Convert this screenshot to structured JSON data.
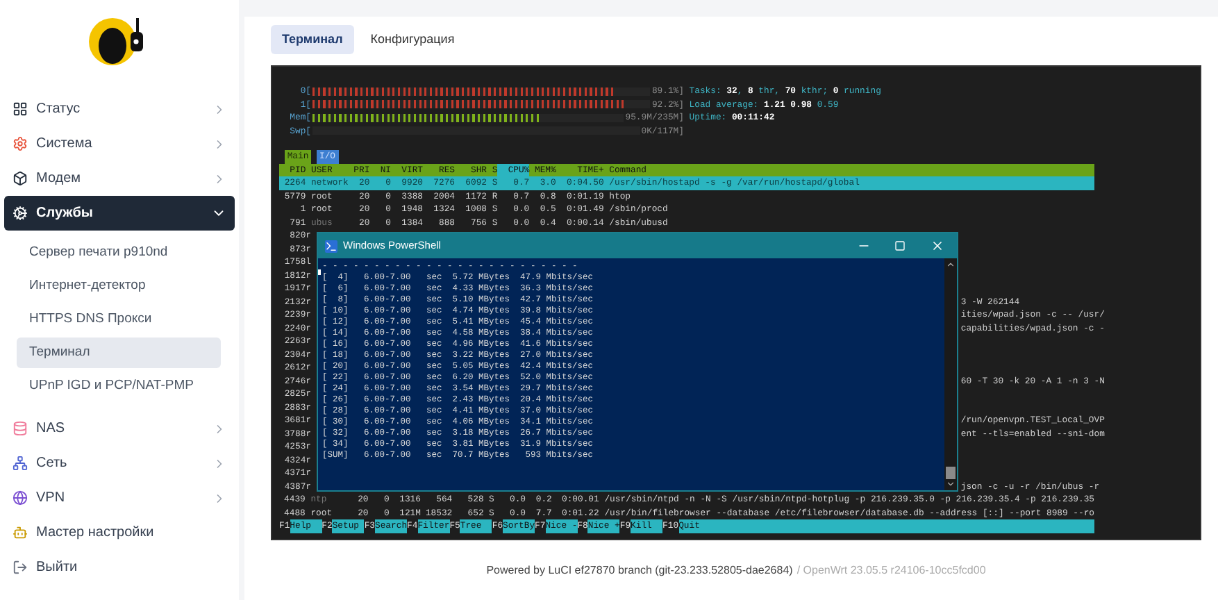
{
  "sidebar": {
    "items": [
      {
        "label": "Статус",
        "expanded": false,
        "selected": false
      },
      {
        "label": "Система",
        "expanded": false,
        "selected": false
      },
      {
        "label": "Модем",
        "expanded": false,
        "selected": false
      },
      {
        "label": "Службы",
        "expanded": true,
        "selected": true,
        "children": [
          {
            "label": "Сервер печати p910nd",
            "selected": false
          },
          {
            "label": "Интернет-детектор",
            "selected": false
          },
          {
            "label": "HTTPS DNS Прокси",
            "selected": false
          },
          {
            "label": "Терминал",
            "selected": true
          },
          {
            "label": "UPnP IGD и PCP/NAT-PMP",
            "selected": false
          }
        ]
      },
      {
        "label": "NAS",
        "expanded": false,
        "selected": false
      },
      {
        "label": "Сеть",
        "expanded": false,
        "selected": false
      },
      {
        "label": "VPN",
        "expanded": false,
        "selected": false
      },
      {
        "label": "Мастер настройки",
        "selected": false
      },
      {
        "label": "Выйти",
        "selected": false
      }
    ]
  },
  "tabs": [
    {
      "label": "Терминал",
      "selected": true
    },
    {
      "label": "Конфигурация",
      "selected": false
    }
  ],
  "htop": {
    "meters": [
      {
        "label": "0[",
        "reading": "89.1%]",
        "level": 0.89,
        "color": "#c0392b"
      },
      {
        "label": "1[",
        "reading": "92.2%]",
        "level": 0.92,
        "color": "#c0392b"
      },
      {
        "label": "Mem[",
        "reading": "95.9M/235M]",
        "level": 0.73,
        "color": "#7fb31a"
      },
      {
        "label": "Swp[",
        "reading": "0K/117M]"
      }
    ],
    "summary": [
      "Tasks: **32**, **8** thr, **70** kthr; **0** running",
      "Load average: **1.21** **0.98** 0.59",
      "Uptime: **00:11:42**"
    ],
    "tabs": [
      {
        "label": "Main",
        "selected": true
      },
      {
        "label": "I/O",
        "selected": false
      }
    ],
    "columns": [
      {
        "label": "PID",
        "sorted": false
      },
      {
        "label": "USER",
        "sorted": false
      },
      {
        "label": "PRI",
        "sorted": false
      },
      {
        "label": "NI",
        "sorted": false
      },
      {
        "label": "VIRT",
        "sorted": false
      },
      {
        "label": "RES",
        "sorted": false
      },
      {
        "label": "SHR",
        "sorted": false
      },
      {
        "label": "S",
        "sorted": false
      },
      {
        "label": "CPU%",
        "sorted": true
      },
      {
        "label": "MEM%",
        "sorted": false
      },
      {
        "label": "TIME+",
        "sorted": false
      },
      {
        "label": "Command",
        "sorted": false
      }
    ],
    "rows": [
      {
        "kind": "full",
        "selected": true,
        "dim": false,
        "cells": [
          "2264",
          "network",
          "20",
          "0",
          "9920",
          "7276",
          "6092",
          "S",
          "0.7",
          "3.0",
          "0:04.50",
          "/usr/sbin/hostapd -s -g /var/run/hostapd/global"
        ]
      },
      {
        "kind": "full",
        "selected": false,
        "dim": false,
        "cells": [
          "5779",
          "root",
          "20",
          "0",
          "3388",
          "2004",
          "1172",
          "R",
          "0.7",
          "0.8",
          "0:01.19",
          "htop"
        ]
      },
      {
        "kind": "full",
        "selected": false,
        "dim": false,
        "cells": [
          "1",
          "root",
          "20",
          "0",
          "1948",
          "1324",
          "1008",
          "S",
          "0.0",
          "0.5",
          "0:01.49",
          "/sbin/procd"
        ]
      },
      {
        "kind": "full",
        "selected": false,
        "dim": true,
        "cells": [
          "791",
          "ubus",
          "20",
          "0",
          "1384",
          "888",
          "756",
          "S",
          "0.0",
          "0.4",
          "0:00.14",
          "/sbin/ubusd"
        ]
      },
      {
        "kind": "covered",
        "pid": "820",
        "user": "r"
      },
      {
        "kind": "covered",
        "pid": "873",
        "user": "r"
      },
      {
        "kind": "covered",
        "pid": "1758",
        "user": "l"
      },
      {
        "kind": "covered",
        "pid": "1812",
        "user": "r"
      },
      {
        "kind": "covered",
        "pid": "1917",
        "user": "r"
      },
      {
        "kind": "covered",
        "pid": "2132",
        "user": "r",
        "tail": "3 -W 262144"
      },
      {
        "kind": "covered",
        "pid": "2239",
        "user": "r",
        "tail": "ities/wpad.json -c -- /usr/"
      },
      {
        "kind": "covered",
        "pid": "2240",
        "user": "r",
        "tail": "capabilities/wpad.json -c -"
      },
      {
        "kind": "covered",
        "pid": "2263",
        "user": "r"
      },
      {
        "kind": "covered",
        "pid": "2304",
        "user": "r"
      },
      {
        "kind": "covered",
        "pid": "2612",
        "user": "r"
      },
      {
        "kind": "covered",
        "pid": "2746",
        "user": "r",
        "tail": "60 -T 30 -k 20 -A 1 -n 3 -N"
      },
      {
        "kind": "covered",
        "pid": "2825",
        "user": "r"
      },
      {
        "kind": "covered",
        "pid": "2883",
        "user": "r"
      },
      {
        "kind": "covered",
        "pid": "3681",
        "user": "r",
        "tail": "/run/openvpn.TEST_Local_OVP"
      },
      {
        "kind": "covered",
        "pid": "3788",
        "user": "r",
        "tail": "ent --tls=enabled --sni-dom"
      },
      {
        "kind": "covered",
        "pid": "4253",
        "user": "r"
      },
      {
        "kind": "covered",
        "pid": "4324",
        "user": "r"
      },
      {
        "kind": "covered",
        "pid": "4371",
        "user": "r"
      },
      {
        "kind": "covered",
        "pid": "4387",
        "user": "r",
        "tail": "json -c -u -r /bin/ubus -r"
      },
      {
        "kind": "full",
        "selected": false,
        "dim": true,
        "cells": [
          "4439",
          "ntp",
          "20",
          "0",
          "1316",
          "564",
          "528",
          "S",
          "0.0",
          "0.2",
          "0:00.01",
          "/usr/sbin/ntpd -n -N -S /usr/sbin/ntpd-hotplug -p 216.239.35.0 -p 216.239.35.4 -p 216.239.35"
        ]
      },
      {
        "kind": "full",
        "selected": false,
        "dim": false,
        "cells": [
          "4488",
          "root",
          "20",
          "0",
          "121M",
          "18532",
          "652",
          "S",
          "0.0",
          "7.7",
          "0:01.22",
          "/usr/bin/filebrowser --database /etc/filebrowser/database.db --address [::] --port 8989 --ro"
        ]
      }
    ],
    "fkeys": [
      {
        "key": "F1",
        "label": "Help"
      },
      {
        "key": "F2",
        "label": "Setup"
      },
      {
        "key": "F3",
        "label": "Search"
      },
      {
        "key": "F4",
        "label": "Filter"
      },
      {
        "key": "F5",
        "label": "Tree"
      },
      {
        "key": "F6",
        "label": "SortBy"
      },
      {
        "key": "F7",
        "label": "Nice -"
      },
      {
        "key": "F8",
        "label": "Nice +"
      },
      {
        "key": "F9",
        "label": "Kill"
      },
      {
        "key": "F10",
        "label": "Quit"
      }
    ]
  },
  "powershell": {
    "title": "Windows PowerShell",
    "lines": [
      "- - - - - - - - - - - - - - - - - - - - - - - - -",
      "[  4]   6.00-7.00   sec  5.72 MBytes  47.9 Mbits/sec",
      "[  6]   6.00-7.00   sec  4.33 MBytes  36.3 Mbits/sec",
      "[  8]   6.00-7.00   sec  5.10 MBytes  42.7 Mbits/sec",
      "[ 10]   6.00-7.00   sec  4.74 MBytes  39.8 Mbits/sec",
      "[ 12]   6.00-7.00   sec  5.41 MBytes  45.4 Mbits/sec",
      "[ 14]   6.00-7.00   sec  4.58 MBytes  38.4 Mbits/sec",
      "[ 16]   6.00-7.00   sec  4.96 MBytes  41.6 Mbits/sec",
      "[ 18]   6.00-7.00   sec  3.22 MBytes  27.0 Mbits/sec",
      "[ 20]   6.00-7.00   sec  5.05 MBytes  42.4 Mbits/sec",
      "[ 22]   6.00-7.00   sec  6.20 MBytes  52.0 Mbits/sec",
      "[ 24]   6.00-7.00   sec  3.54 MBytes  29.7 Mbits/sec",
      "[ 26]   6.00-7.00   sec  2.43 MBytes  20.4 Mbits/sec",
      "[ 28]   6.00-7.00   sec  4.41 MBytes  37.0 Mbits/sec",
      "[ 30]   6.00-7.00   sec  4.06 MBytes  34.1 Mbits/sec",
      "[ 32]   6.00-7.00   sec  3.18 MBytes  26.7 Mbits/sec",
      "[ 34]   6.00-7.00   sec  3.81 MBytes  31.9 Mbits/sec",
      "[SUM]   6.00-7.00   sec  70.7 MBytes   593 Mbits/sec"
    ]
  },
  "footer": {
    "luci": "Powered by LuCI ef27870 branch (git-23.233.52805-dae2684)",
    "openwrt": "/ OpenWrt 23.05.5 r24106-10cc5fcd00"
  }
}
